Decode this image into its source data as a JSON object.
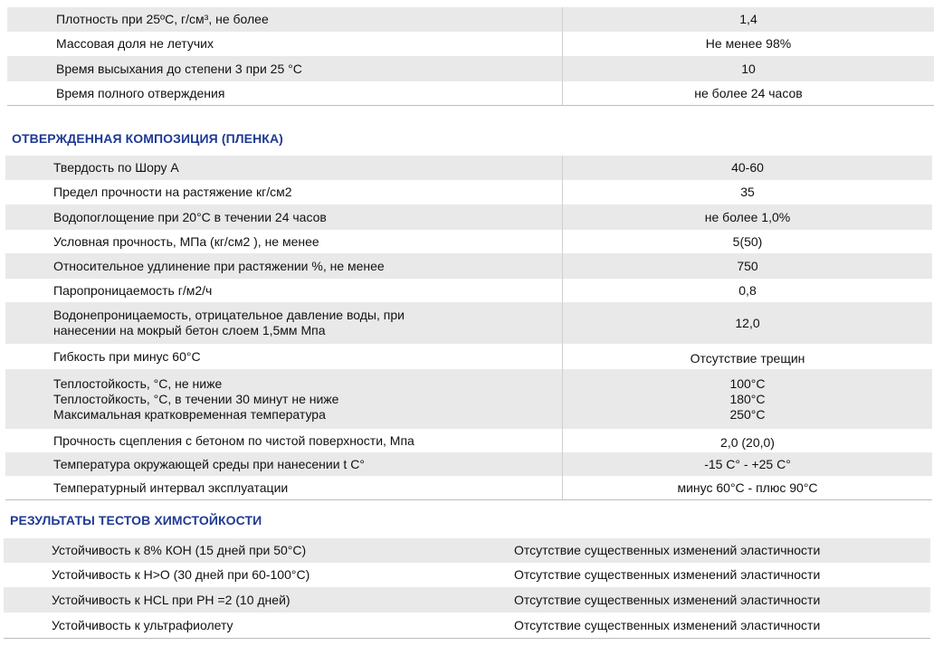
{
  "table1": {
    "rows": [
      {
        "name": "Плотность при 25ºС, г/см³, не более",
        "value": "1,4"
      },
      {
        "name": "Массовая доля не летучих",
        "value": "Не менее 98%"
      },
      {
        "name": "Время высыхания до степени 3 при 25 °С",
        "value": "10"
      },
      {
        "name": "Время полного отверждения",
        "value": "не более 24 часов"
      }
    ]
  },
  "section2": {
    "title": "ОТВЕРЖДЕННАЯ КОМПОЗИЦИЯ (ПЛЕНКА)"
  },
  "table2": {
    "rows": [
      {
        "name": "Твердость по Шору А",
        "value": "40-60"
      },
      {
        "name": "Предел прочности на растяжение кг/см2",
        "value": "35"
      },
      {
        "name": "Водопоглощение при 20°С в течении 24 часов",
        "value": "не более 1,0%"
      },
      {
        "name": "Условная прочность, МПа (кг/см2 ), не менее",
        "value": "5(50)"
      },
      {
        "name": "Относительное удлинение при растяжении %, не менее",
        "value": "750"
      },
      {
        "name": "Паропроницаемость г/м2/ч",
        "value": "0,8"
      },
      {
        "name": "Водонепроницаемость, отрицательное давление воды, при\nнанесении на мокрый бетон слоем 1,5мм Мпа",
        "value": "12,0"
      },
      {
        "name": "Гибкость при минус 60°С",
        "value": "Отсутствие трещин"
      },
      {
        "name": "Теплостойкость, °С, не ниже\nТеплостойкость, °С, в течении 30 минут не ниже\nМаксимальная кратковременная температура",
        "value": "100°С\n180°С\n250°С"
      },
      {
        "name": "Прочность сцепления с бетоном по чистой поверхности, Мпа",
        "value": "2,0 (20,0)"
      },
      {
        "name": "Температура окружающей среды при нанесении t С°",
        "value": "-15 С° - +25 С°"
      },
      {
        "name": "Температурный интервал эксплуатации",
        "value": "минус 60°С - плюс 90°С"
      }
    ]
  },
  "section3": {
    "title": "РЕЗУЛЬТАТЫ ТЕСТОВ ХИМСТОЙКОСТИ"
  },
  "table3": {
    "rows": [
      {
        "name": "Устойчивость к 8% КОН (15 дней при 50°С)",
        "value": "Отсутствие существенных изменений эластичности"
      },
      {
        "name": "Устойчивость к Н>О (30 дней при 60-100°С)",
        "value": "Отсутствие существенных изменений эластичности"
      },
      {
        "name": "Устойчивость к HCL при РН =2 (10 дней)",
        "value": "Отсутствие существенных изменений эластичности"
      },
      {
        "name": "Устойчивость к ультрафиолету",
        "value": "Отсутствие существенных изменений эластичности"
      }
    ]
  }
}
